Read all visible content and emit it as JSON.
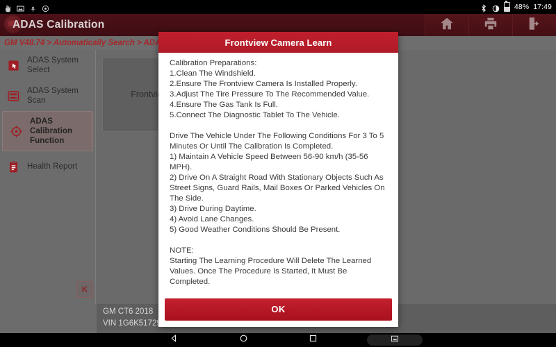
{
  "statusbar": {
    "icons_left": [
      "touch-pointer-icon",
      "screenshot-icon",
      "usb-icon",
      "settings-gear-icon"
    ],
    "icons_right": [
      "bluetooth-icon",
      "brightness-icon",
      "battery-icon"
    ],
    "battery_percent": "48%",
    "time": "17:49"
  },
  "titlebar": {
    "app_title": "ADAS Calibration",
    "actions": [
      {
        "name": "home-button",
        "icon": "home-icon"
      },
      {
        "name": "print-button",
        "icon": "printer-icon"
      },
      {
        "name": "exit-button",
        "icon": "exit-door-icon"
      }
    ]
  },
  "breadcrumb": {
    "text": "GM V48.74 > Automatically Search > ADAS Calibration"
  },
  "sidebar": {
    "items": [
      {
        "label": "ADAS System Select",
        "icon": "cursor-select-icon",
        "active": false
      },
      {
        "label": "ADAS System Scan",
        "icon": "scan-list-icon",
        "active": false
      },
      {
        "label": "ADAS Calibration Function",
        "icon": "crosshair-target-icon",
        "active": true
      },
      {
        "label": "Health Report",
        "icon": "clipboard-report-icon",
        "active": false
      }
    ],
    "collapse_label": "K"
  },
  "content": {
    "card_title": "Frontview Camera Learn"
  },
  "vehicle": {
    "model": "GM CT6 2018",
    "vin": "VIN 1G6K51729J8500000"
  },
  "dialog": {
    "title": "Frontview Camera Learn",
    "prep_heading": "Calibration Preparations:",
    "prep_steps": [
      "1.Clean The Windshield.",
      "2.Ensure The Frontview Camera Is Installed Properly.",
      "3.Adjust The Tire Pressure To The Recommended Value.",
      "4.Ensure The Gas Tank Is Full.",
      "5.Connect The Diagnostic Tablet To The Vehicle."
    ],
    "drive_intro": "Drive The Vehicle Under The Following Conditions For 3 To 5 Minutes Or Until The Calibration Is Completed.",
    "drive_conditions": [
      "1) Maintain A Vehicle Speed Between 56-90 km/h (35-56 MPH).",
      "2) Drive On A Straight Road With Stationary Objects Such As Street Signs, Guard Rails, Mail Boxes Or Parked Vehicles On The Side.",
      "3) Drive During Daytime.",
      "4) Avoid Lane Changes.",
      "5) Good Weather Conditions Should Be Present."
    ],
    "note_heading": "NOTE:",
    "note_text": "Starting The Learning Procedure Will Delete The Learned Values. Once The Procedure Is Started, It Must Be Completed.",
    "ok_label": "OK"
  },
  "navbar": {
    "buttons": [
      "back-triangle-icon",
      "home-circle-icon",
      "recents-square-icon",
      "screenshot-image-icon"
    ]
  },
  "colors": {
    "brand_red": "#b01b27",
    "title_dark_red": "#4d1118",
    "page_gray": "#6a6a6a",
    "breadcrumb_link": "#a5282c"
  }
}
